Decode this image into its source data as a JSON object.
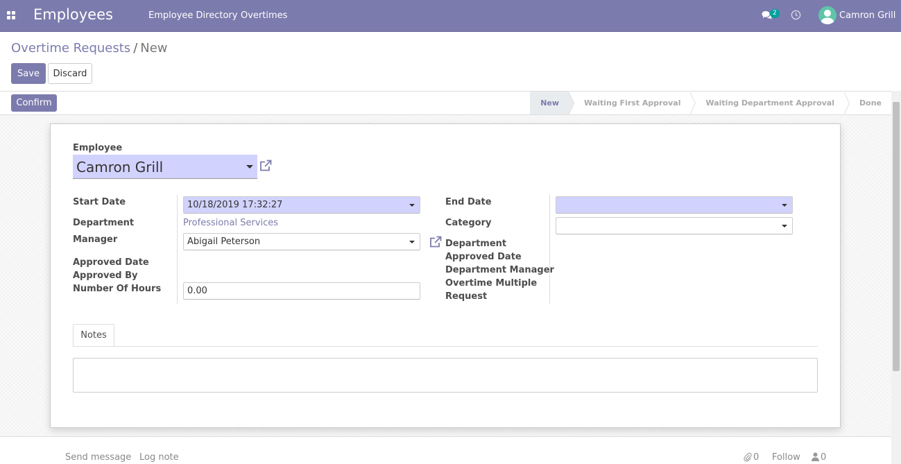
{
  "nav": {
    "app_title": "Employees",
    "menu": [
      "Employee Directory",
      "Overtimes"
    ],
    "messages_count": "2",
    "user_name": "Camron Grill"
  },
  "breadcrumb": {
    "parent": "Overtime Requests",
    "separator": "/",
    "current": "New"
  },
  "buttons": {
    "save": "Save",
    "discard": "Discard",
    "confirm": "Confirm"
  },
  "stages": {
    "items": [
      "New",
      "Waiting First Approval",
      "Waiting Department Approval",
      "Done"
    ],
    "active": "New"
  },
  "form": {
    "employee_label": "Employee",
    "employee_value": "Camron Grill",
    "left": {
      "start_date_label": "Start Date",
      "start_date_value": "10/18/2019 17:32:27",
      "department_label": "Department",
      "department_value": "Professional Services",
      "manager_label": "Manager",
      "manager_value": "Abigail Peterson",
      "approved_date_label": "Approved Date",
      "approved_by_label": "Approved By",
      "hours_label": "Number Of Hours",
      "hours_value": "0.00"
    },
    "right": {
      "end_date_label": "End Date",
      "end_date_value": "",
      "category_label": "Category",
      "category_value": "",
      "dept_approved_label_1": "Department",
      "dept_approved_label_2": "Approved Date",
      "dept_manager_label": "Department Manager",
      "overtime_label_1": "Overtime Multiple",
      "overtime_label_2": "Request"
    },
    "tabs": [
      "Notes"
    ],
    "notes_value": ""
  },
  "chatter": {
    "send_message": "Send message",
    "log_note": "Log note",
    "attachments_count": "0",
    "follow": "Follow",
    "followers_count": "0"
  },
  "colors": {
    "brand": "#7c7bad",
    "required_field": "#d2d2ff",
    "badge": "#00a09d"
  }
}
